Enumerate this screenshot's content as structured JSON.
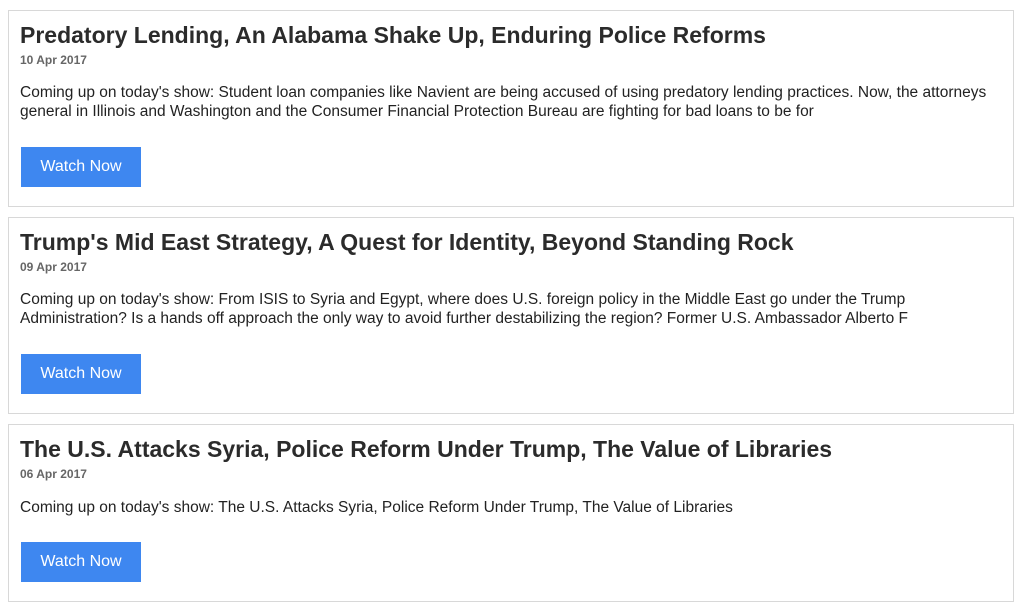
{
  "episodes": [
    {
      "title": "Predatory Lending, An Alabama Shake Up, Enduring Police Reforms",
      "date": "10 Apr 2017",
      "summary": "Coming up on today's show: Student loan companies like Navient are being accused of using predatory lending practices. Now, the attorneys general in Illinois and Washington and the Consumer Financial Protection Bureau are fighting for bad loans to be for",
      "button_label": "Watch Now"
    },
    {
      "title": "Trump's Mid East Strategy, A Quest for Identity, Beyond Standing Rock",
      "date": "09 Apr 2017",
      "summary": "Coming up on today's show: From ISIS to Syria and Egypt, where does U.S. foreign policy in the Middle East go under the Trump Administration? Is a hands off approach the only way to avoid further destabilizing the region? Former U.S. Ambassador Alberto F",
      "button_label": "Watch Now"
    },
    {
      "title": "The U.S. Attacks Syria, Police Reform Under Trump, The Value of Libraries",
      "date": "06 Apr 2017",
      "summary": "Coming up on today's show: The U.S. Attacks Syria, Police Reform Under Trump, The Value of Libraries",
      "button_label": "Watch Now"
    }
  ],
  "colors": {
    "button_background": "#3e87f0",
    "button_text": "#ffffff",
    "card_border": "#d8d8d8",
    "title_text": "#2b2b2b",
    "date_text": "#666666"
  }
}
